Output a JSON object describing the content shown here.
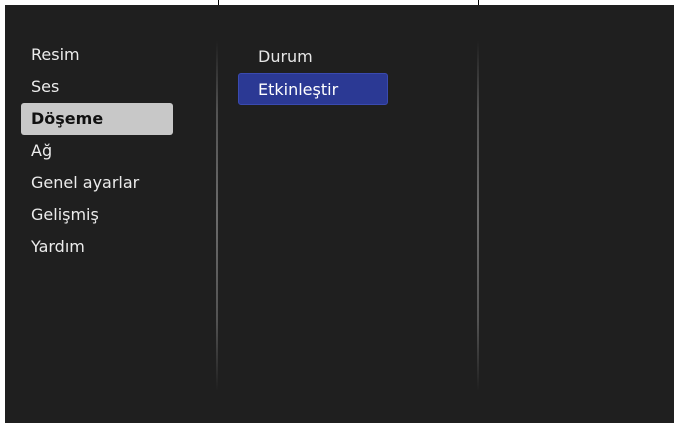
{
  "colors": {
    "screen_background": "#1f1f1f",
    "menu_text": "#ececec",
    "menu_selected_background": "#c8c8c8",
    "menu_selected_text": "#111111",
    "submenu_active_background": "#2b3994",
    "divider": "#787878"
  },
  "main_menu": {
    "items": [
      {
        "label": "Resim"
      },
      {
        "label": "Ses"
      },
      {
        "label": "Döşeme"
      },
      {
        "label": "Ağ"
      },
      {
        "label": "Genel ayarlar"
      },
      {
        "label": "Gelişmiş"
      },
      {
        "label": "Yardım"
      }
    ],
    "selected": "Döşeme"
  },
  "submenu": {
    "items": [
      {
        "label": "Durum"
      },
      {
        "label": "Etkinleştir"
      }
    ],
    "active": "Etkinleştir"
  }
}
